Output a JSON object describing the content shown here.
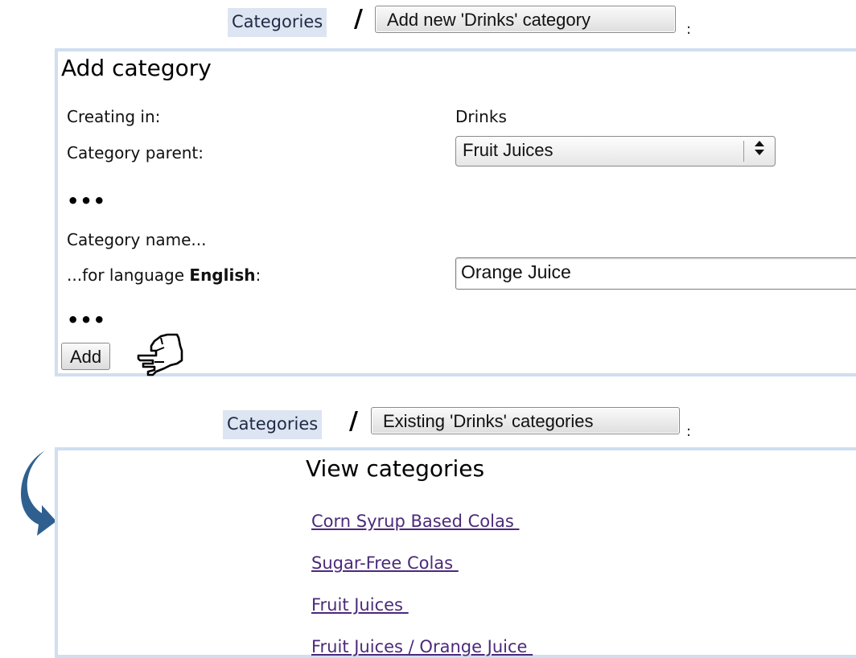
{
  "top_breadcrumb": {
    "link": "Categories",
    "separator": "/",
    "button": "Add new 'Drinks' category",
    "trailing": ":"
  },
  "add_panel": {
    "title": "Add category",
    "creating_in_label": "Creating in:",
    "creating_in_value": "Drinks",
    "parent_label": "Category parent:",
    "parent_value": "Fruit Juices",
    "ellipsis_1": "•••",
    "name_label": "Category name...",
    "language_prefix": "...for language ",
    "language_name": "English",
    "language_suffix": ":",
    "name_value": "Orange Juice",
    "ellipsis_2": "•••",
    "add_button": "Add"
  },
  "bottom_breadcrumb": {
    "link": "Categories",
    "separator": "/",
    "button": "Existing 'Drinks' categories",
    "trailing": ":"
  },
  "view_panel": {
    "title": "View categories",
    "categories": [
      "Corn Syrup Based Colas ",
      "Sugar-Free Colas ",
      "Fruit Juices ",
      "Fruit Juices / Orange Juice "
    ]
  },
  "colors": {
    "panel_border": "#cfdff0",
    "breadcrumb_bg": "#dde4f2",
    "link": "#4b2a7a",
    "arrow": "#2f5f8f"
  },
  "icons": {
    "pointer": "hand-pointer-icon",
    "flow": "curved-arrow-icon",
    "select": "updown-arrows-icon"
  }
}
